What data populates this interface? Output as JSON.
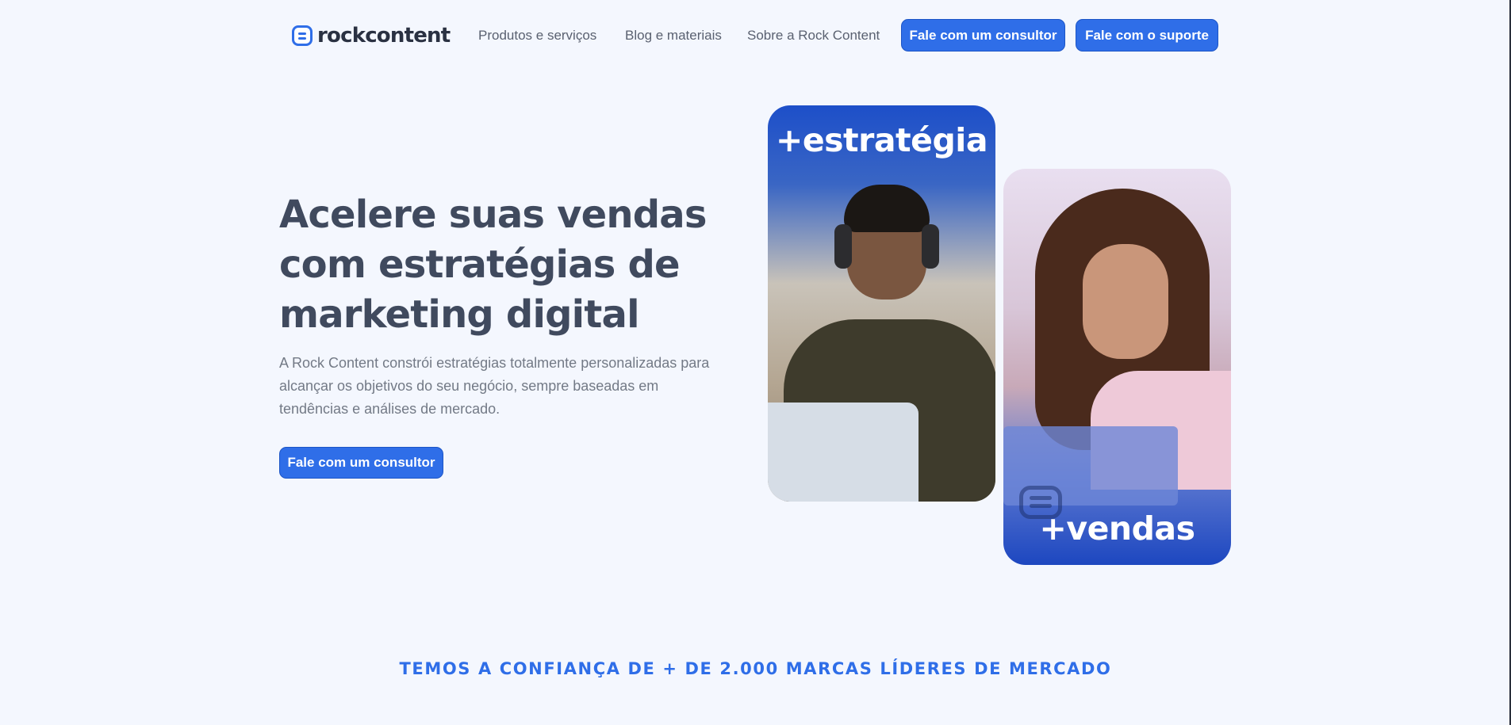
{
  "brand": {
    "logo_text": "rockcontent",
    "accent": "#2f6ee8"
  },
  "nav": {
    "items": [
      {
        "label": "Produtos e serviços"
      },
      {
        "label": "Blog e materiais"
      },
      {
        "label": "Sobre a Rock Content"
      }
    ],
    "cta_consultant": "Fale com um consultor",
    "cta_support": "Fale com o suporte"
  },
  "hero": {
    "title": "Acelere suas vendas com estratégias de marketing digital",
    "description": "A Rock Content constrói estratégias totalmente personalizadas para alcançar os objetivos do seu negócio, sempre baseadas em tendências e análises de mercado.",
    "cta": "Fale com um consultor",
    "card1_label": "+estratégia",
    "card2_label": "+vendas"
  },
  "trust": {
    "text": "TEMOS A CONFIANÇA DE + DE 2.000 MARCAS LÍDERES DE MERCADO"
  }
}
